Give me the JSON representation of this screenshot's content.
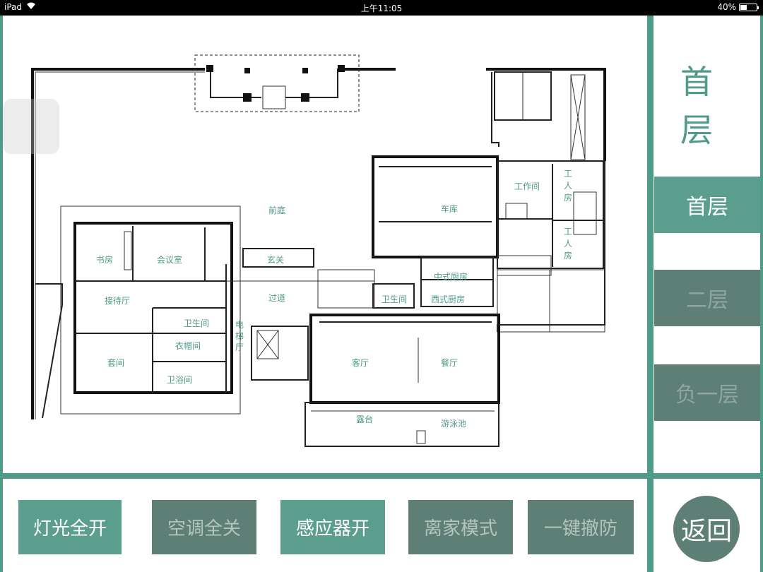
{
  "status_bar": {
    "device": "iPad",
    "time": "上午11:05",
    "battery": "40%",
    "battery_level": 0.4
  },
  "floor_title": {
    "line1": "首",
    "line2": "层"
  },
  "floors": [
    {
      "label": "首层",
      "active": true
    },
    {
      "label": "二层",
      "active": false
    },
    {
      "label": "负一层",
      "active": false
    }
  ],
  "rooms": {
    "front_court": "前庭",
    "garage": "车库",
    "workroom": "工作间",
    "worker_room_1": [
      "工",
      "人",
      "房"
    ],
    "worker_room_2": [
      "工",
      "人",
      "房"
    ],
    "study": "书房",
    "meeting": "会议室",
    "foyer": "玄关",
    "corridor": "过道",
    "chinese_kitchen": "中式厨房",
    "western_kitchen": "西式厨房",
    "toilet_1": "卫生间",
    "toilet_2": "卫生间",
    "reception": "接待厅",
    "elevator": [
      "电",
      "梯",
      "厅"
    ],
    "wardrobe": "衣帽间",
    "suite": "套间",
    "bath": "卫浴间",
    "living": "客厅",
    "dining": "餐厅",
    "terrace": "露台",
    "pool": "游泳池"
  },
  "commands": [
    {
      "label": "灯光全开",
      "active": true
    },
    {
      "label": "空调全关",
      "active": false
    },
    {
      "label": "感应器开",
      "active": true
    },
    {
      "label": "离家模式",
      "active": false
    },
    {
      "label": "一键撤防",
      "active": false
    }
  ],
  "back_label": "返回"
}
